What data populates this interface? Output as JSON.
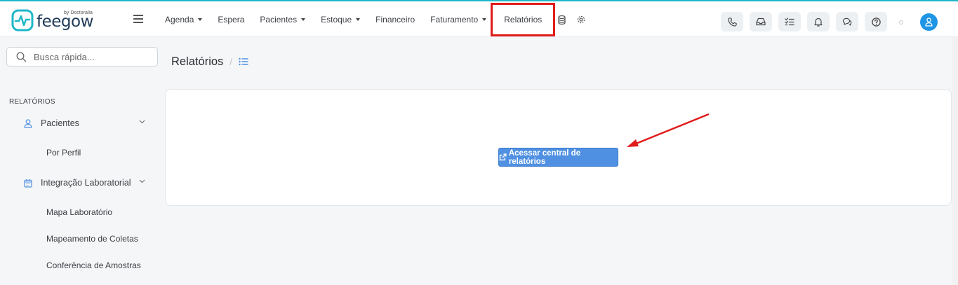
{
  "brand": {
    "name": "feegow",
    "tagline": "by Doctoralia"
  },
  "nav": {
    "items": [
      {
        "label": "Agenda",
        "dropdown": true
      },
      {
        "label": "Espera",
        "dropdown": false
      },
      {
        "label": "Pacientes",
        "dropdown": true
      },
      {
        "label": "Estoque",
        "dropdown": true
      },
      {
        "label": "Financeiro",
        "dropdown": false
      },
      {
        "label": "Faturamento",
        "dropdown": true
      },
      {
        "label": "Relatórios",
        "dropdown": false,
        "active": true
      }
    ],
    "extra_icons": [
      "database-icon",
      "gear-icon"
    ]
  },
  "header_buttons": [
    "phone-icon",
    "inbox-icon",
    "tasks-icon",
    "bell-icon",
    "chat-icon",
    "help-icon"
  ],
  "search": {
    "placeholder": "Busca rápida..."
  },
  "sidebar": {
    "heading": "RELATÓRIOS",
    "groups": [
      {
        "label": "Pacientes",
        "icon": "user-icon",
        "children": [
          "Por Perfil"
        ]
      },
      {
        "label": "Integração Laboratorial",
        "icon": "calendar-icon",
        "children": [
          "Mapa Laboratório",
          "Mapeamento de Coletas",
          "Conferência de Amostras"
        ]
      }
    ]
  },
  "breadcrumb": {
    "title": "Relatórios",
    "separator": "/"
  },
  "main": {
    "button_label": "Acessar central de relatórios"
  },
  "colors": {
    "accent": "#4f90e2",
    "highlight": "#e01b1b",
    "avatar": "#1f95e6",
    "topline": "#1fb7c9"
  }
}
